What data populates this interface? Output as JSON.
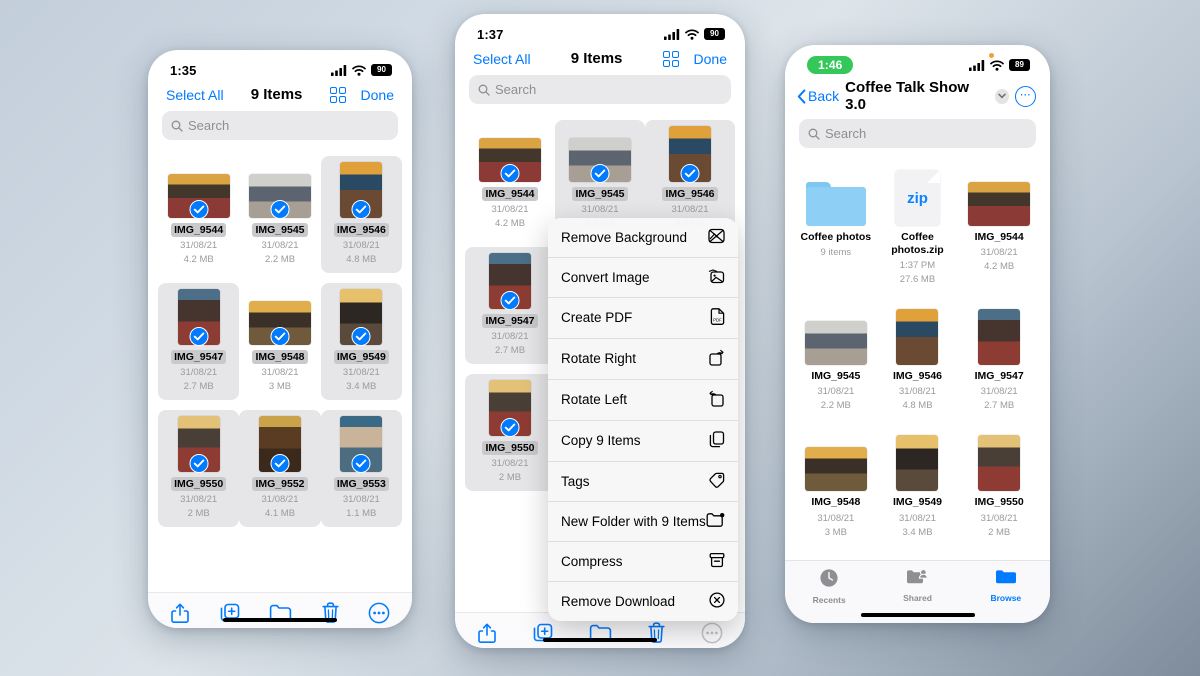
{
  "background": {
    "accent": "#007aff",
    "green": "#34c759",
    "gradient_from": "#c3cedb",
    "gradient_to": "#7e8c9b"
  },
  "phone_left": {
    "status": {
      "time": "1:35",
      "battery": "90",
      "wifi_icon": "wifi-icon",
      "cellular_icon": "cellular-icon"
    },
    "nav": {
      "select_all": "Select All",
      "title": "9 Items",
      "grid_icon": "grid-view-icon",
      "done": "Done"
    },
    "search": {
      "placeholder": "Search",
      "icon": "search-icon"
    },
    "files": [
      {
        "name": "IMG_9544",
        "date": "31/08/21",
        "size": "4.2 MB",
        "orientation": "landscape",
        "selected": true,
        "highlighted": true,
        "cell_bg": false,
        "swatch": "p1"
      },
      {
        "name": "IMG_9545",
        "date": "31/08/21",
        "size": "2.2 MB",
        "orientation": "landscape",
        "selected": true,
        "highlighted": true,
        "cell_bg": false,
        "swatch": "p2"
      },
      {
        "name": "IMG_9546",
        "date": "31/08/21",
        "size": "4.8 MB",
        "orientation": "portrait",
        "selected": true,
        "highlighted": true,
        "cell_bg": true,
        "swatch": "p3"
      },
      {
        "name": "IMG_9547",
        "date": "31/08/21",
        "size": "2.7 MB",
        "orientation": "portrait",
        "selected": true,
        "highlighted": true,
        "cell_bg": true,
        "swatch": "p4"
      },
      {
        "name": "IMG_9548",
        "date": "31/08/21",
        "size": "3 MB",
        "orientation": "landscape",
        "selected": true,
        "highlighted": true,
        "cell_bg": false,
        "swatch": "p5"
      },
      {
        "name": "IMG_9549",
        "date": "31/08/21",
        "size": "3.4 MB",
        "orientation": "portrait",
        "selected": true,
        "highlighted": true,
        "cell_bg": true,
        "swatch": "p6"
      },
      {
        "name": "IMG_9550",
        "date": "31/08/21",
        "size": "2 MB",
        "orientation": "portrait",
        "selected": true,
        "highlighted": true,
        "cell_bg": true,
        "swatch": "p7"
      },
      {
        "name": "IMG_9552",
        "date": "31/08/21",
        "size": "4.1 MB",
        "orientation": "portrait",
        "selected": true,
        "highlighted": true,
        "cell_bg": true,
        "swatch": "p8"
      },
      {
        "name": "IMG_9553",
        "date": "31/08/21",
        "size": "1.1 MB",
        "orientation": "portrait",
        "selected": true,
        "highlighted": true,
        "cell_bg": true,
        "swatch": "p9"
      }
    ],
    "toolbar": [
      {
        "icon": "share-icon",
        "label": "Share"
      },
      {
        "icon": "duplicate-icon",
        "label": "Duplicate"
      },
      {
        "icon": "folder-icon",
        "label": "Move"
      },
      {
        "icon": "trash-icon",
        "label": "Delete"
      },
      {
        "icon": "more-icon",
        "label": "More"
      }
    ]
  },
  "phone_middle": {
    "status": {
      "time": "1:37",
      "battery": "90"
    },
    "nav": {
      "select_all": "Select All",
      "title": "9 Items",
      "grid_icon": "grid-view-icon",
      "done": "Done"
    },
    "search": {
      "placeholder": "Search",
      "icon": "search-icon"
    },
    "files": [
      {
        "name": "IMG_9544",
        "date": "31/08/21",
        "size": "4.2 MB",
        "orientation": "landscape",
        "selected": true,
        "highlighted": true,
        "cell_bg": false,
        "swatch": "p1"
      },
      {
        "name": "IMG_9545",
        "date": "31/08/21",
        "size": "2.2 MB",
        "orientation": "landscape",
        "selected": true,
        "highlighted": true,
        "cell_bg": true,
        "swatch": "p2"
      },
      {
        "name": "IMG_9546",
        "date": "31/08/21",
        "size": "4.8 MB",
        "orientation": "portrait",
        "selected": true,
        "highlighted": true,
        "cell_bg": true,
        "swatch": "p3"
      },
      {
        "name": "IMG_9547",
        "date": "31/08/21",
        "size": "2.7 MB",
        "orientation": "portrait",
        "selected": true,
        "highlighted": true,
        "cell_bg": true,
        "swatch": "p4"
      },
      {
        "name": "IMG_9550",
        "date": "31/08/21",
        "size": "2 MB",
        "orientation": "portrait",
        "selected": true,
        "highlighted": true,
        "cell_bg": true,
        "swatch": "p7"
      }
    ],
    "context_menu": [
      {
        "label": "Remove Background",
        "icon": "remove-background-icon"
      },
      {
        "label": "Convert Image",
        "icon": "convert-image-icon"
      },
      {
        "label": "Create PDF",
        "icon": "create-pdf-icon"
      },
      {
        "label": "Rotate Right",
        "icon": "rotate-right-icon"
      },
      {
        "label": "Rotate Left",
        "icon": "rotate-left-icon"
      },
      {
        "label": "Copy 9 Items",
        "icon": "copy-icon"
      },
      {
        "label": "Tags",
        "icon": "tag-icon"
      },
      {
        "label": "New Folder with 9 Items",
        "icon": "new-folder-icon"
      },
      {
        "label": "Compress",
        "icon": "compress-icon"
      },
      {
        "label": "Remove Download",
        "icon": "remove-download-icon"
      }
    ],
    "toolbar": [
      {
        "icon": "share-icon",
        "label": "Share"
      },
      {
        "icon": "duplicate-icon",
        "label": "Duplicate"
      },
      {
        "icon": "folder-icon",
        "label": "Move"
      },
      {
        "icon": "trash-icon",
        "label": "Delete"
      },
      {
        "icon": "more-icon",
        "label": "More"
      }
    ]
  },
  "phone_right": {
    "status": {
      "time": "1:46",
      "battery": "89",
      "time_pill": true
    },
    "nav": {
      "back": "Back",
      "title": "Coffee Talk Show 3.0",
      "chevron_icon": "chevron-down-icon",
      "more_icon": "more-circle-icon"
    },
    "search": {
      "placeholder": "Search",
      "icon": "search-icon"
    },
    "files": [
      {
        "name": "Coffee photos",
        "type": "folder",
        "icon": "folder-icon",
        "line1": "9 items",
        "line2": ""
      },
      {
        "name": "Coffee photos.zip",
        "type": "zip",
        "icon": "zip-file-icon",
        "badge": "zip",
        "line1": "1:37 PM",
        "line2": "27.6 MB"
      },
      {
        "name": "IMG_9544",
        "type": "photo",
        "orientation": "landscape",
        "line1": "31/08/21",
        "line2": "4.2 MB",
        "swatch": "p1"
      },
      {
        "name": "IMG_9545",
        "type": "photo",
        "orientation": "landscape",
        "line1": "31/08/21",
        "line2": "2.2 MB",
        "swatch": "p2"
      },
      {
        "name": "IMG_9546",
        "type": "photo",
        "orientation": "portrait",
        "line1": "31/08/21",
        "line2": "4.8 MB",
        "swatch": "p3"
      },
      {
        "name": "IMG_9547",
        "type": "photo",
        "orientation": "portrait",
        "line1": "31/08/21",
        "line2": "2.7 MB",
        "swatch": "p4"
      },
      {
        "name": "IMG_9548",
        "type": "photo",
        "orientation": "landscape",
        "line1": "31/08/21",
        "line2": "3 MB",
        "swatch": "p5"
      },
      {
        "name": "IMG_9549",
        "type": "photo",
        "orientation": "portrait",
        "line1": "31/08/21",
        "line2": "3.4 MB",
        "swatch": "p6"
      },
      {
        "name": "IMG_9550",
        "type": "photo",
        "orientation": "portrait",
        "line1": "31/08/21",
        "line2": "2 MB",
        "swatch": "p7"
      }
    ],
    "tabs": [
      {
        "label": "Recents",
        "icon": "clock-icon",
        "active": false
      },
      {
        "label": "Shared",
        "icon": "shared-folder-icon",
        "active": false
      },
      {
        "label": "Browse",
        "icon": "folder-icon",
        "active": true
      }
    ]
  }
}
